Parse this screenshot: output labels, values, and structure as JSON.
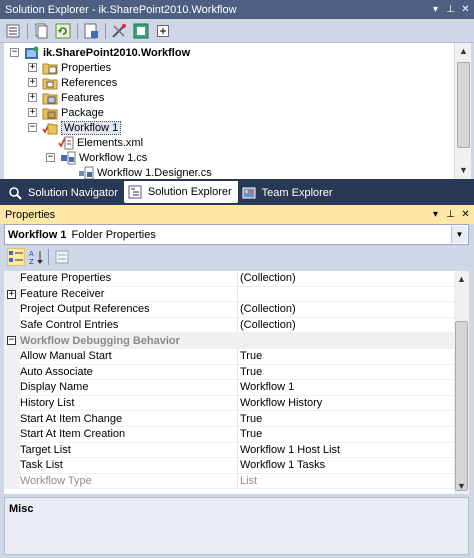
{
  "solution_explorer": {
    "title": "Solution Explorer - ik.SharePoint2010.Workflow",
    "title_buttons": [
      "▾",
      "⊥",
      "✕"
    ],
    "toolbar": [
      "properties-icon",
      "show-all-files-icon",
      "refresh-icon",
      "view-code-icon",
      "view-designer-icon",
      "class-diagram-icon",
      "add-icon"
    ],
    "tree": [
      {
        "label": "ik.SharePoint2010.Workflow",
        "expander": "−",
        "bold": true,
        "icon": "project-icon"
      },
      {
        "label": "Properties",
        "expander": "+",
        "icon": "properties-folder-icon"
      },
      {
        "label": "References",
        "expander": "+",
        "icon": "references-icon"
      },
      {
        "label": "Features",
        "expander": "+",
        "icon": "features-icon"
      },
      {
        "label": "Package",
        "expander": "+",
        "icon": "package-icon"
      },
      {
        "label": "Workflow 1",
        "expander": "−",
        "icon": "workflow-folder-icon",
        "selected": true
      },
      {
        "label": "Elements.xml",
        "expander": "",
        "icon": "xml-file-icon"
      },
      {
        "label": "Workflow 1.cs",
        "expander": "−",
        "icon": "cs-file-icon"
      },
      {
        "label": "Workflow 1.Designer.cs",
        "expander": "",
        "icon": "cs-designer-file-icon"
      }
    ]
  },
  "tabs": [
    {
      "label": "Solution Navigator",
      "icon": "navigator-icon",
      "active": false
    },
    {
      "label": "Solution Explorer",
      "icon": "solution-explorer-icon",
      "active": true
    },
    {
      "label": "Team Explorer",
      "icon": "team-explorer-icon",
      "active": false
    }
  ],
  "properties": {
    "title": "Properties",
    "title_buttons": [
      "▾",
      "⊥",
      "✕"
    ],
    "object_name": "Workflow 1",
    "object_type": "Folder Properties",
    "rows": [
      {
        "name": "Feature Properties",
        "value": "(Collection)",
        "type": "prop"
      },
      {
        "name": "Feature Receiver",
        "value": "",
        "type": "prop",
        "expander": "+"
      },
      {
        "name": "Project Output References",
        "value": "(Collection)",
        "type": "prop"
      },
      {
        "name": "Safe Control Entries",
        "value": "(Collection)",
        "type": "prop"
      },
      {
        "name": "Workflow Debugging Behavior",
        "value": "",
        "type": "category",
        "expander": "−"
      },
      {
        "name": "Allow Manual Start",
        "value": "True",
        "type": "prop"
      },
      {
        "name": "Auto Associate",
        "value": "True",
        "type": "prop"
      },
      {
        "name": "Display Name",
        "value": "Workflow 1",
        "type": "prop"
      },
      {
        "name": "History List",
        "value": "Workflow History",
        "type": "prop"
      },
      {
        "name": "Start At Item Change",
        "value": "True",
        "type": "prop"
      },
      {
        "name": "Start At Item Creation",
        "value": "True",
        "type": "prop"
      },
      {
        "name": "Target List",
        "value": "Workflow 1 Host List",
        "type": "prop"
      },
      {
        "name": "Task List",
        "value": "Workflow 1 Tasks",
        "type": "prop"
      },
      {
        "name": "Workflow Type",
        "value": "List",
        "type": "prop",
        "disabled": true
      }
    ],
    "description_title": "Misc"
  },
  "colors": {
    "frame": "#293955",
    "inactive_title": "#4d6082",
    "active_title": "#ffe8a6",
    "toolbar": "#cfd6e5"
  }
}
